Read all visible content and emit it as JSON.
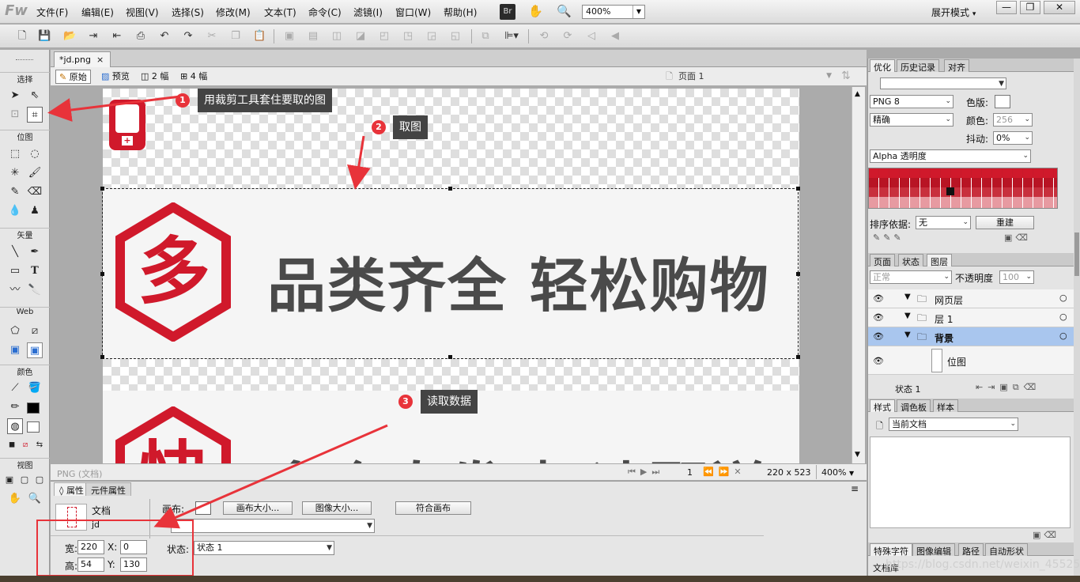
{
  "app": {
    "logo": "Fw",
    "menus": [
      "文件(F)",
      "编辑(E)",
      "视图(V)",
      "选择(S)",
      "修改(M)",
      "文本(T)",
      "命令(C)",
      "滤镜(I)",
      "窗口(W)",
      "帮助(H)"
    ],
    "br_label": "Br",
    "zoom": "400%",
    "mode": "展开模式",
    "win_buttons": [
      "—",
      "❐",
      "✕"
    ]
  },
  "tools": {
    "sections": [
      "选择",
      "位图",
      "矢量",
      "Web",
      "颜色",
      "视图"
    ],
    "selected": "crop-tool"
  },
  "document": {
    "tab": "*jd.png",
    "tab_close": "×",
    "views": [
      "原始",
      "预览",
      "2 幅",
      "4 幅"
    ],
    "page": "页面 1",
    "text_line1": "品类齐全  轻松购物",
    "text_line2": "多仓直发  极速配送",
    "badge1": "多",
    "badge2": "快"
  },
  "annotations": [
    {
      "num": "1",
      "text": "用裁剪工具套住要取的图"
    },
    {
      "num": "2",
      "text": "取图"
    },
    {
      "num": "3",
      "text": "读取数据"
    }
  ],
  "statusbar": {
    "left": "PNG (文档)",
    "frame": "1",
    "size": "220 x 523",
    "zoom": "400%"
  },
  "properties": {
    "tabs": [
      "属性",
      "元件属性"
    ],
    "doc_label": "文档",
    "doc_name": "jd",
    "canvas_label": "画布:",
    "btn_canvas_size": "画布大小...",
    "btn_image_size": "图像大小...",
    "btn_fit": "符合画布",
    "width_label": "宽:",
    "width": "220",
    "height_label": "高:",
    "height": "54",
    "x_label": "X:",
    "x": "0",
    "y_label": "Y:",
    "y": "130",
    "state_label": "状态:",
    "state_value": "状态 1"
  },
  "optimize": {
    "tabs": [
      "优化",
      "历史记录",
      "对齐"
    ],
    "format": "PNG 8",
    "quality": "精确",
    "palette_label": "色版:",
    "colors_label": "颜色:",
    "colors": "256",
    "dither_label": "抖动:",
    "dither": "0%",
    "alpha": "Alpha 透明度",
    "sort_label": "排序依据:",
    "sort_value": "无",
    "rebuild": "重建"
  },
  "layers": {
    "tabs": [
      "页面",
      "状态",
      "图层"
    ],
    "blend": "正常",
    "opacity_label": "不透明度",
    "opacity": "100",
    "items": [
      "网页层",
      "层 1",
      "背景",
      "位图"
    ],
    "footer_state": "状态 1"
  },
  "styles": {
    "tabs": [
      "样式",
      "调色板",
      "样本"
    ],
    "source": "当前文档"
  },
  "bottom_tabs": [
    "特殊字符",
    "图像编辑",
    "路径",
    "自动形状"
  ],
  "bottom_text": "文档库",
  "watermark": "https://blog.csdn.net/weixin_45525272",
  "colors": {
    "accent_red": "#d0192b",
    "annot_red": "#e8333a",
    "layer_highlight": "#a9c6ee"
  }
}
